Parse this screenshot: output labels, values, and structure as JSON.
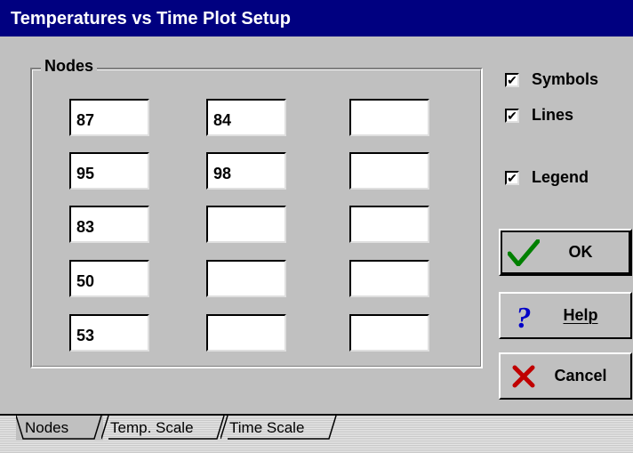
{
  "window": {
    "title": "Temperatures vs Time Plot Setup"
  },
  "nodes_group": {
    "label": "Nodes",
    "rows": [
      [
        "87",
        "84",
        ""
      ],
      [
        "95",
        "98",
        ""
      ],
      [
        "83",
        "",
        ""
      ],
      [
        "50",
        "",
        ""
      ],
      [
        "53",
        "",
        ""
      ]
    ]
  },
  "options": {
    "symbols": {
      "label": "Symbols",
      "checked": true
    },
    "lines": {
      "label": "Lines",
      "checked": true
    },
    "legend": {
      "label": "Legend",
      "checked": true
    }
  },
  "buttons": {
    "ok": {
      "label": "OK",
      "icon": "check-icon"
    },
    "help": {
      "label": "Help",
      "icon": "question-icon"
    },
    "cancel": {
      "label": "Cancel",
      "icon": "cancel-x-icon"
    }
  },
  "tabs": [
    {
      "label": "Nodes",
      "active": true
    },
    {
      "label": "Temp. Scale",
      "active": false
    },
    {
      "label": "Time Scale",
      "active": false
    }
  ]
}
